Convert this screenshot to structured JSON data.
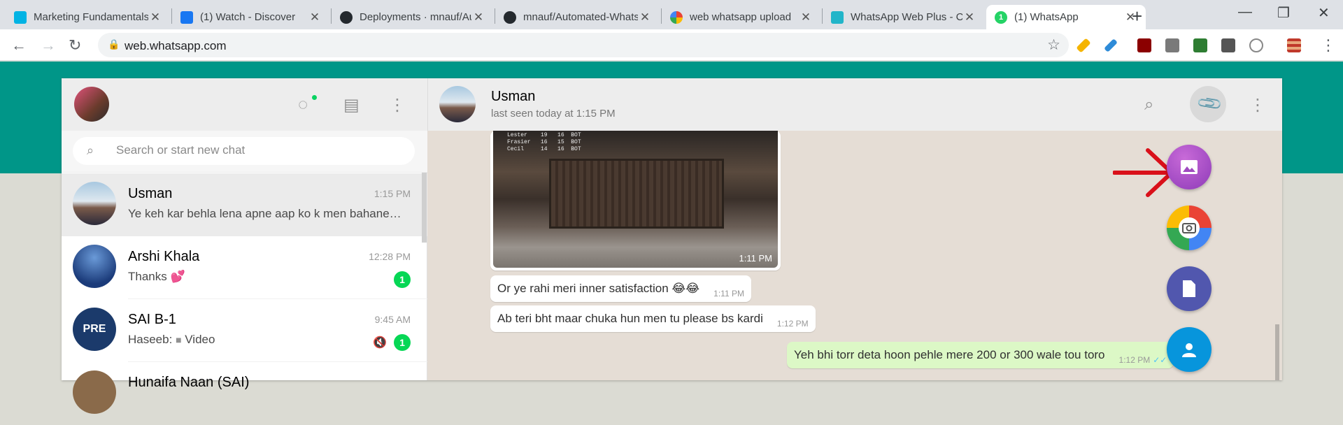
{
  "browser": {
    "tabs": [
      {
        "title": "Marketing Fundamentals",
        "icon": "udacity-icon",
        "color": "#02b3e4"
      },
      {
        "title": "(1) Watch - Discover",
        "icon": "facebook-icon",
        "color": "#1877f2"
      },
      {
        "title": "Deployments · mnauf/Automated-Wh",
        "icon": "github-icon",
        "color": "#24292e"
      },
      {
        "title": "mnauf/Automated-WhatsApp",
        "icon": "github-icon",
        "color": "#24292e"
      },
      {
        "title": "web whatsapp upload",
        "icon": "google-icon",
        "color": "#4285f4"
      },
      {
        "title": "WhatsApp Web Plus - Chrome",
        "icon": "puzzle-icon",
        "color": "#22b5c9"
      },
      {
        "title": "(1) WhatsApp",
        "icon": "whatsapp-icon",
        "color": "#25d366",
        "badge": "1"
      }
    ],
    "url": "web.whatsapp.com"
  },
  "sidebar": {
    "search_placeholder": "Search or start new chat",
    "chats": [
      {
        "name": "Usman",
        "time": "1:15 PM",
        "message": "Ye keh kar behla lena apne aap ko k men bahane…",
        "unread": ""
      },
      {
        "name": "Arshi Khala",
        "time": "12:28 PM",
        "message": "Thanks 💕",
        "unread": "1"
      },
      {
        "name": "SAI B-1",
        "time": "9:45 AM",
        "sender": "Haseeb:",
        "message": "Video",
        "unread": "1",
        "muted": true,
        "avatar_text": "PRE"
      },
      {
        "name": "Hunaifa Naan (SAI)",
        "time": "",
        "message": "",
        "unread": ""
      }
    ]
  },
  "conversation": {
    "contact_name": "Usman",
    "status": "last seen today at 1:15 PM",
    "image_message": {
      "time": "1:11 PM",
      "table_rows": [
        "Lester    19   16  BOT",
        "Frasier   16   15  BOT",
        "Cecil     14   16  BOT"
      ]
    },
    "messages": [
      {
        "text": "Or ye rahi meri inner satisfaction 😂😂",
        "time": "1:11 PM",
        "direction": "in"
      },
      {
        "text": "Ab teri bht maar chuka hun men tu please bs kardi",
        "time": "1:12 PM",
        "direction": "in"
      },
      {
        "text": "Yeh bhi torr deta hoon pehle mere 200 or 300 wale tou toro",
        "time": "1:12 PM",
        "direction": "out"
      }
    ],
    "attach_menu": [
      "Photos & Videos",
      "Camera",
      "Document",
      "Contact"
    ]
  }
}
